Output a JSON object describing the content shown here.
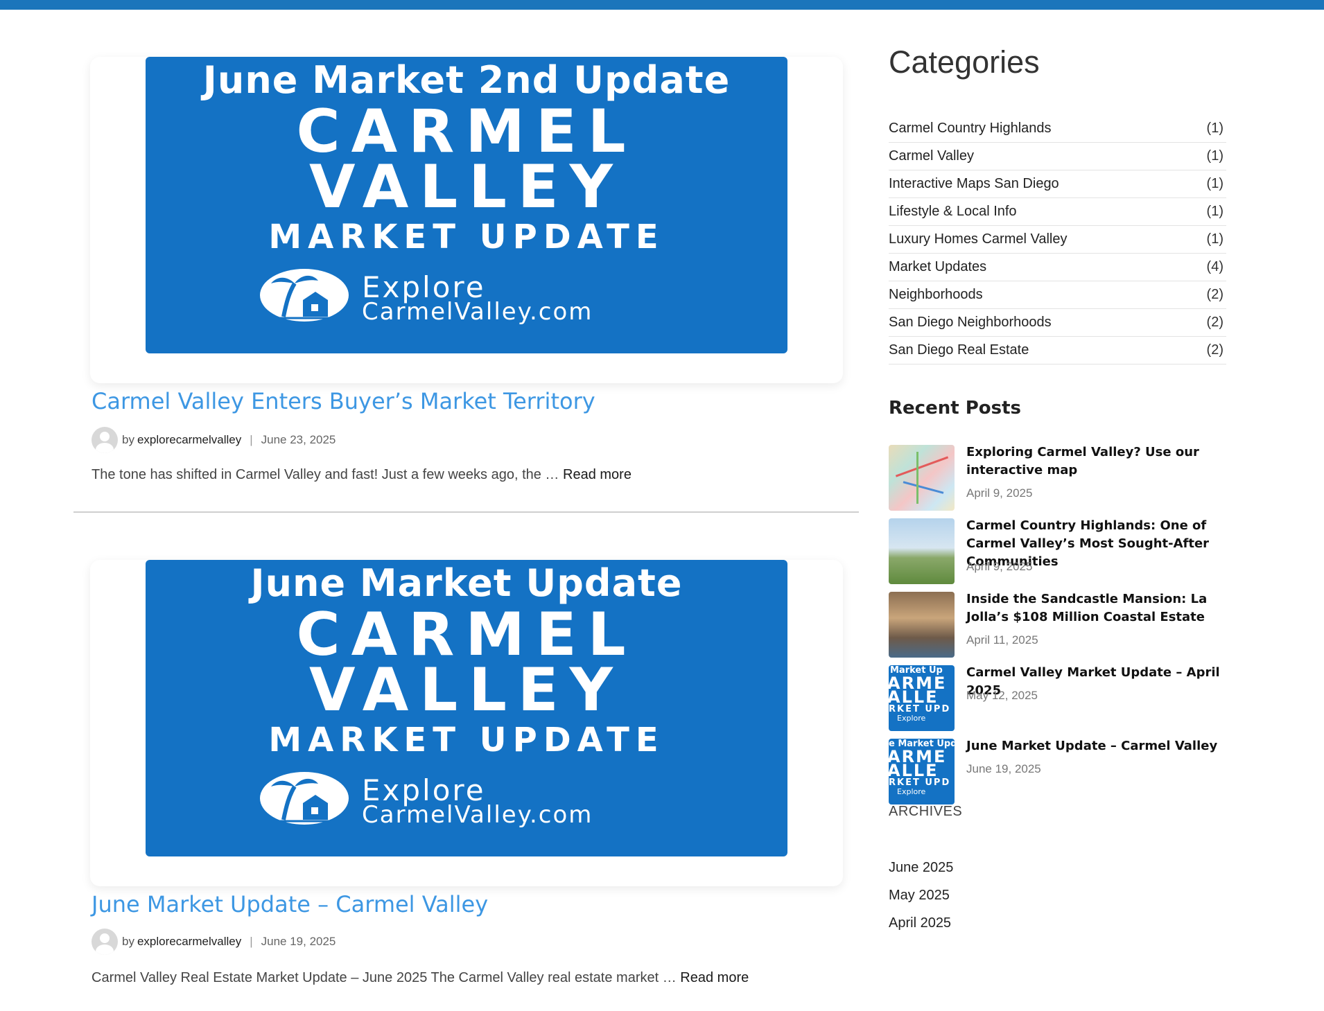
{
  "posts": [
    {
      "banner": {
        "line1": "June Market 2nd Update",
        "line2": "CARMEL",
        "line3": "VALLEY",
        "line4": "MARKET UPDATE",
        "brand1": "Explore",
        "brand2": "CarmelValley.com"
      },
      "title": "Carmel Valley Enters Buyer’s Market Territory",
      "by": "by",
      "author": "explorecarmelvalley",
      "separator": "|",
      "date": "June 23, 2025",
      "excerpt": "The tone has shifted in Carmel Valley and fast! Just a few weeks ago, the …",
      "read_more": "Read more"
    },
    {
      "banner": {
        "line1": "June Market Update",
        "line2": "CARMEL",
        "line3": "VALLEY",
        "line4": "MARKET UPDATE",
        "brand1": "Explore",
        "brand2": "CarmelValley.com"
      },
      "title": "June Market Update – Carmel Valley",
      "by": "by",
      "author": "explorecarmelvalley",
      "separator": "|",
      "date": "June 19, 2025",
      "excerpt": "Carmel Valley Real Estate Market Update – June 2025 The Carmel Valley real estate market …",
      "read_more": "Read more"
    }
  ],
  "sidebar": {
    "categories_heading": "Categories",
    "categories": [
      {
        "label": "Carmel Country Highlands",
        "count": "(1)"
      },
      {
        "label": "Carmel Valley",
        "count": "(1)"
      },
      {
        "label": "Interactive Maps San Diego",
        "count": "(1)"
      },
      {
        "label": "Lifestyle & Local Info",
        "count": "(1)"
      },
      {
        "label": "Luxury Homes Carmel Valley",
        "count": "(1)"
      },
      {
        "label": "Market Updates",
        "count": "(4)"
      },
      {
        "label": "Neighborhoods",
        "count": "(2)"
      },
      {
        "label": "San Diego Neighborhoods",
        "count": "(2)"
      },
      {
        "label": "San Diego Real Estate",
        "count": "(2)"
      }
    ],
    "recent_heading": "Recent Posts",
    "recent": [
      {
        "title": "Exploring Carmel Valley? Use our interactive map",
        "date": "April 9, 2025"
      },
      {
        "title": "Carmel Country Highlands: One of Carmel Valley’s Most Sought-After Communities",
        "date": "April 9, 2025"
      },
      {
        "title": "Inside the Sandcastle Mansion: La Jolla’s $108 Million Coastal Estate",
        "date": "April 11, 2025"
      },
      {
        "title": "Carmel Valley Market Update – April 2025",
        "date": "May 12, 2025"
      },
      {
        "title": "June Market Update – Carmel Valley",
        "date": "June 19, 2025"
      }
    ],
    "thumb_text": [
      "Market Up",
      "ARME",
      "ALLE",
      "RKET UPD",
      "Explore",
      "e Market Upda",
      "ARME",
      "ALLE",
      "RKET UPD",
      "Explore"
    ],
    "archives_heading": "ARCHIVES",
    "archives": [
      "June 2025",
      "May 2025",
      "April 2025"
    ]
  },
  "colors": {
    "topbar": "#1b75bb",
    "banner": "#1472c4",
    "post_title": "#3d97e3"
  }
}
